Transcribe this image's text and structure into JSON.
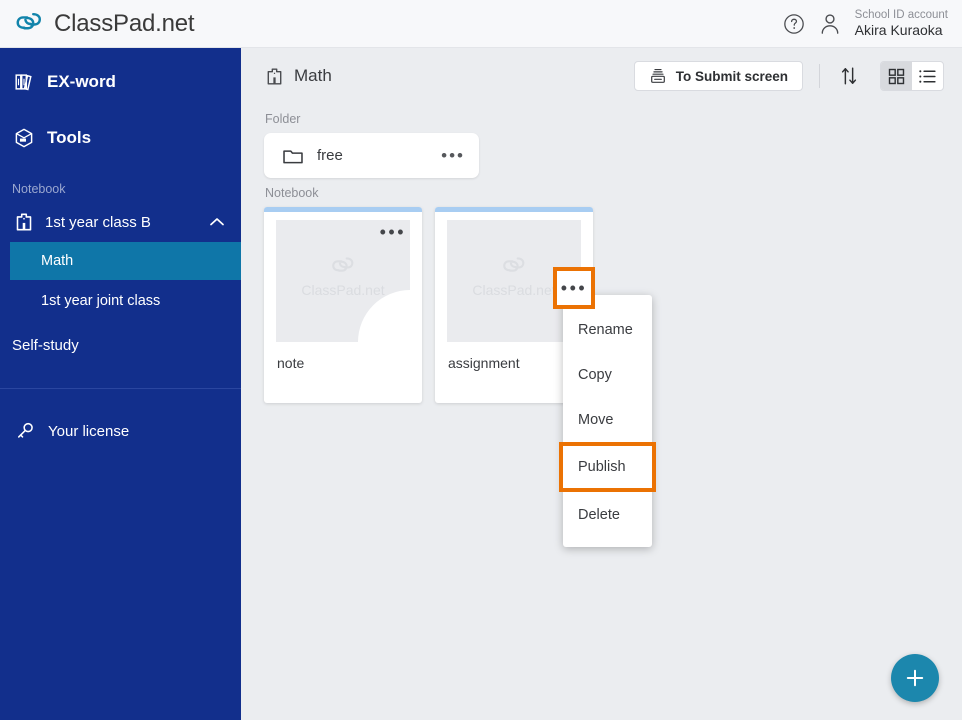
{
  "header": {
    "brand": "ClassPad.net",
    "brand_logo_icon": "chain-link-icon",
    "help_icon": "question-circle-icon",
    "user_icon": "person-icon",
    "account_label": "School ID account",
    "account_name": "Akira Kuraoka"
  },
  "sidebar": {
    "background_color": "#122f8c",
    "active_color": "#0f76a8",
    "items": [
      {
        "label": "EX-word",
        "icon": "books-icon"
      },
      {
        "label": "Tools",
        "icon": "toolbox-icon"
      }
    ],
    "section_label": "Notebook",
    "class": {
      "label": "1st year class B",
      "icon": "school-building-icon",
      "chevron": "chevron-up-icon"
    },
    "sub_items": [
      {
        "label": "Math",
        "active": true
      },
      {
        "label": "1st year joint class",
        "active": false
      }
    ],
    "self_study": "Self-study",
    "license": {
      "label": "Your license",
      "icon": "key-icon"
    }
  },
  "content": {
    "title": "Math",
    "title_icon": "school-building-icon",
    "submit_button": {
      "label": "To Submit screen",
      "icon": "submit-tray-icon"
    },
    "sort_icon": "sort-arrows-icon",
    "view_grid_icon": "grid-view-icon",
    "view_list_icon": "list-view-icon",
    "view_active": "grid",
    "folder_section_label": "Folder",
    "folders": [
      {
        "name": "free",
        "icon": "folder-icon",
        "menu_icon": "ellipsis-icon"
      }
    ],
    "notebook_section_label": "Notebook",
    "notebooks": [
      {
        "name": "note",
        "watermark": "ClassPad.net",
        "menu_icon": "ellipsis-icon"
      },
      {
        "name": "assignment",
        "watermark": "ClassPad.net",
        "menu_icon": "ellipsis-icon"
      }
    ],
    "context_menu": {
      "items": [
        "Rename",
        "Copy",
        "Move",
        "Publish",
        "Delete"
      ],
      "highlighted": "Publish",
      "highlight_color": "#eb7203"
    },
    "fab": {
      "icon": "plus-icon",
      "color": "#1c87ad"
    }
  }
}
